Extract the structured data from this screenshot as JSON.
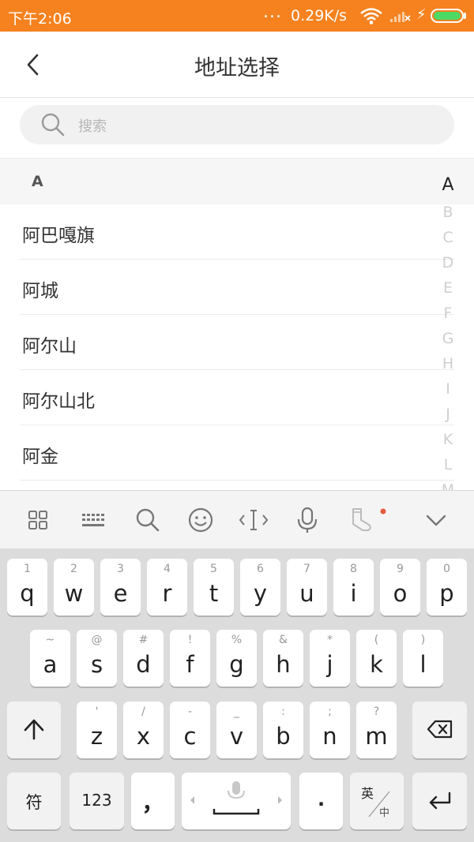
{
  "status_bar": {
    "time": "下午2:06",
    "dots": "...",
    "network_speed": "0.29K/s",
    "icons": [
      "wifi-icon",
      "signal-off-icon",
      "charging-bolt-icon",
      "battery-icon"
    ],
    "background_color": "#f5821f"
  },
  "header": {
    "title": "地址选择",
    "back_icon": "chevron-left-icon"
  },
  "search": {
    "placeholder": "搜索",
    "icon": "search-icon"
  },
  "section": {
    "letter": "A"
  },
  "cities": [
    "阿巴嘎旗",
    "阿城",
    "阿尔山",
    "阿尔山北",
    "阿金"
  ],
  "index_letters": [
    "A",
    "B",
    "C",
    "D",
    "E",
    "F",
    "G",
    "H",
    "I",
    "J",
    "K",
    "L",
    "M"
  ],
  "index_active": "A",
  "keyboard_toolbar": {
    "tools": [
      "grid-menu-icon",
      "keyboard-icon",
      "search-icon",
      "emoji-icon",
      "cursor-icon",
      "microphone-icon",
      "sock-icon",
      "chevron-down-icon"
    ],
    "notification_dot_color": "#e25a3a"
  },
  "keyboard": {
    "row1": [
      {
        "hint": "1",
        "key": "q"
      },
      {
        "hint": "2",
        "key": "w"
      },
      {
        "hint": "3",
        "key": "e"
      },
      {
        "hint": "4",
        "key": "r"
      },
      {
        "hint": "5",
        "key": "t"
      },
      {
        "hint": "6",
        "key": "y"
      },
      {
        "hint": "7",
        "key": "u"
      },
      {
        "hint": "8",
        "key": "i"
      },
      {
        "hint": "9",
        "key": "o"
      },
      {
        "hint": "0",
        "key": "p"
      }
    ],
    "row2": [
      {
        "hint": "~",
        "key": "a"
      },
      {
        "hint": "@",
        "key": "s"
      },
      {
        "hint": "#",
        "key": "d"
      },
      {
        "hint": "!",
        "key": "f"
      },
      {
        "hint": "%",
        "key": "g"
      },
      {
        "hint": "&",
        "key": "h"
      },
      {
        "hint": "*",
        "key": "j"
      },
      {
        "hint": "(",
        "key": "k"
      },
      {
        "hint": ")",
        "key": "l"
      }
    ],
    "row3": [
      {
        "hint": "'",
        "key": "z"
      },
      {
        "hint": "/",
        "key": "x"
      },
      {
        "hint": "-",
        "key": "c"
      },
      {
        "hint": "_",
        "key": "v"
      },
      {
        "hint": ":",
        "key": "b"
      },
      {
        "hint": ";",
        "key": "n"
      },
      {
        "hint": "?",
        "key": "m"
      }
    ],
    "shift_icon": "shift-arrow-icon",
    "backspace_icon": "backspace-icon",
    "symbols_label": "符",
    "numbers_label": "123",
    "comma_label": "，",
    "period_label": ".",
    "lang_top": "英",
    "lang_bottom": "中",
    "enter_icon": "enter-icon",
    "space_mic_icon": "microphone-icon"
  }
}
